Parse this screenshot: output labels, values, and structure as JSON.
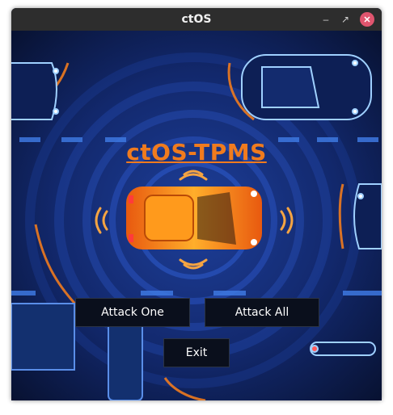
{
  "window": {
    "title": "ctOS"
  },
  "app": {
    "title": "ctOS-TPMS"
  },
  "buttons": {
    "attack_one": "Attack One",
    "attack_all": "Attack All",
    "exit": "Exit"
  },
  "colors": {
    "accent": "#f07b1e",
    "background": "#0b1a4a",
    "titlebar": "#2d2d2d",
    "button": "#0a0f1c",
    "close": "#e0556e"
  }
}
